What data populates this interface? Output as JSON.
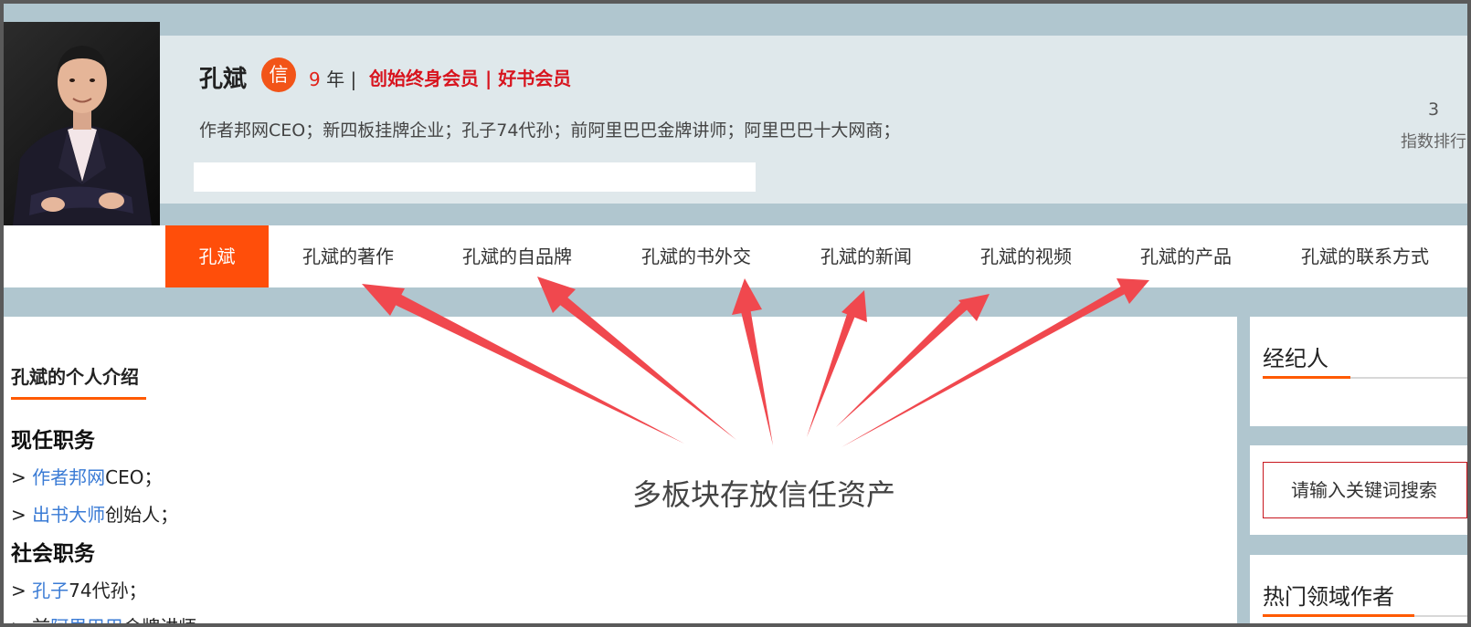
{
  "profile": {
    "name": "孔斌",
    "badge": "信",
    "years_num": "9",
    "years_suffix": " 年 |",
    "membership": "创始终身会员 | 好书会员",
    "bio": "作者邦网CEO；新四板挂牌企业；孔子74代孙；前阿里巴巴金牌讲师；阿里巴巴十大网商；",
    "rank_value": "3",
    "rank_label": "指数排行"
  },
  "nav": {
    "items": [
      {
        "label": "孔斌",
        "active": true
      },
      {
        "label": "孔斌的著作"
      },
      {
        "label": "孔斌的自品牌"
      },
      {
        "label": "孔斌的书外交"
      },
      {
        "label": "孔斌的新闻"
      },
      {
        "label": "孔斌的视频"
      },
      {
        "label": "孔斌的产品"
      },
      {
        "label": "孔斌的联系方式"
      }
    ]
  },
  "intro": {
    "title": "孔斌的个人介绍",
    "current_title": "现任职务",
    "current": [
      {
        "prefix": "> ",
        "link": "作者邦网",
        "rest": "CEO；"
      },
      {
        "prefix": "> ",
        "link": "出书大师",
        "rest": "创始人；"
      }
    ],
    "social_title": "社会职务",
    "social": [
      {
        "prefix": "> ",
        "link": "孔子",
        "rest": "74代孙；"
      },
      {
        "prefix": "> 前",
        "link": "阿里巴巴",
        "rest": "金牌讲师"
      }
    ]
  },
  "annotation": "多板块存放信任资产",
  "sidebar": {
    "agent_title": "经纪人",
    "search_placeholder": "请输入关键词搜索",
    "hot_title": "热门领域作者"
  },
  "colors": {
    "accent": "#ff4e0a",
    "brand_red": "#d8141e",
    "link": "#3a7bd5",
    "arrow": "#f0484e"
  }
}
